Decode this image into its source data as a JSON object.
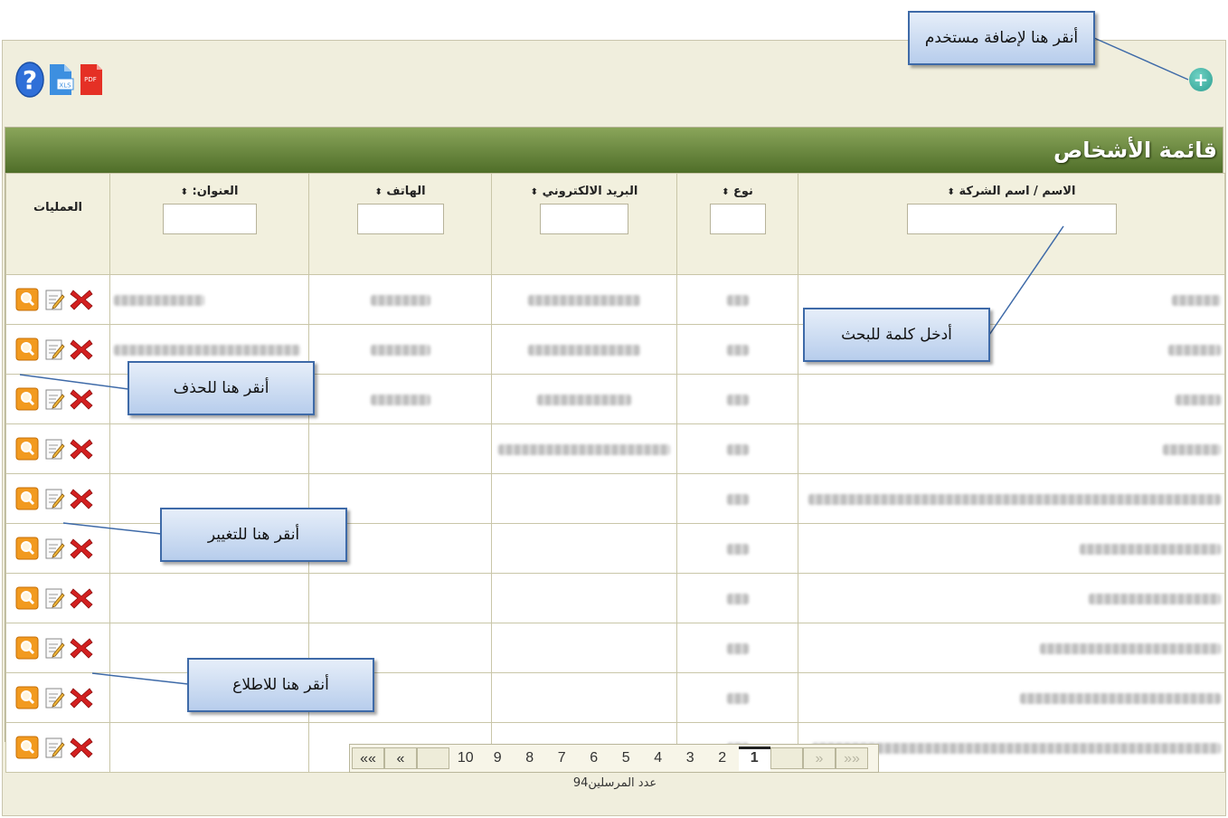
{
  "toolbar": {
    "help_icon": "help-icon",
    "xls_label": "XLS",
    "pdf_label": "PDF",
    "add_symbol": "+"
  },
  "panel": {
    "title": "قائمة الأشخاص"
  },
  "table": {
    "columns": {
      "name": "الاسم / اسم الشركة",
      "type": "نوع",
      "email": "البريد الالكتروني",
      "phone": "الهاتف",
      "address": "العنوان:",
      "operations": "العمليات"
    },
    "sort_indicator": "⬍",
    "rows_count": 10
  },
  "pagination": {
    "first": "««",
    "prev": "«",
    "pages": [
      "1",
      "2",
      "3",
      "4",
      "5",
      "6",
      "7",
      "8",
      "9",
      "10"
    ],
    "current": "1",
    "next": "»",
    "last": "»»"
  },
  "footer": {
    "count_text": "عدد المرسلين94"
  },
  "callouts": {
    "add_user": "أنقر هنا لإضافة مستخدم",
    "search": "أدخل كلمة للبحث",
    "delete": "أنقر هنا للحذف",
    "edit": "أنقر هنا للتغيير",
    "view": "أنقر هنا للاطلاع"
  },
  "colors": {
    "title_bar": "#5e7d33",
    "delete": "#d32020",
    "view": "#f29a1f",
    "add": "#3aa89a"
  }
}
